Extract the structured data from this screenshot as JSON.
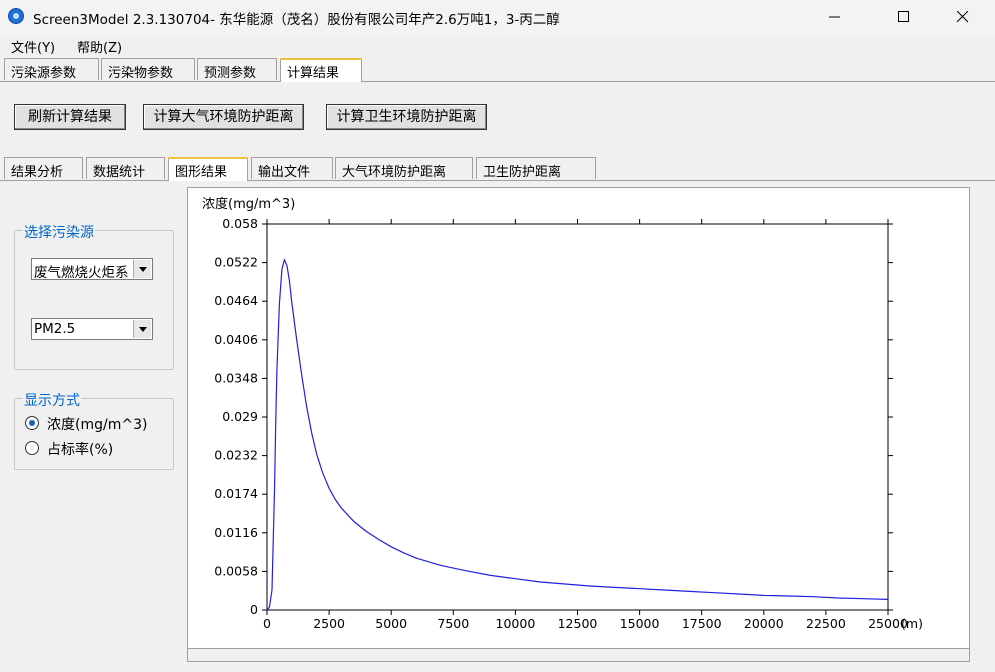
{
  "window": {
    "title": "Screen3Model 2.3.130704- 东华能源（茂名）股份有限公司年产2.6万吨1，3-丙二醇",
    "icon": "app-icon"
  },
  "menu": [
    "文件(Y)",
    "帮助(Z)"
  ],
  "main_tabs": [
    "污染源参数",
    "污染物参数",
    "预测参数",
    "计算结果"
  ],
  "main_active": "计算结果",
  "buttons": {
    "refresh": "刷新计算结果",
    "air_distance": "计算大气环境防护距离",
    "health_distance": "计算卫生环境防护距离"
  },
  "sub_tabs": [
    "结果分析",
    "数据统计",
    "图形结果",
    "输出文件",
    "大气环境防护距离",
    "卫生防护距离"
  ],
  "sub_active": "图形结果",
  "source_group": {
    "legend": "选择污染源",
    "source_value": "废气燃烧火炬系",
    "pollutant_value": "PM2.5"
  },
  "display_group": {
    "legend": "显示方式",
    "options": [
      "浓度(mg/m^3)",
      "占标率(%)"
    ],
    "selected": "浓度(mg/m^3)"
  },
  "chart_data": {
    "type": "line",
    "ylabel": "浓度(mg/m^3)",
    "xlabel_unit": "(m)",
    "x_ticks": [
      0,
      2500,
      5000,
      7500,
      10000,
      12500,
      15000,
      17500,
      20000,
      22500,
      25000
    ],
    "y_ticks": [
      0,
      0.0058,
      0.0116,
      0.0174,
      0.0232,
      0.029,
      0.0348,
      0.0406,
      0.0464,
      0.0522,
      0.058
    ],
    "y_tick_labels": [
      "0",
      "0.0058",
      "0.0116",
      "0.0174",
      "0.0232",
      "0.029",
      "0.0348",
      "0.0406",
      "0.0464",
      "0.0522",
      "0.058"
    ],
    "xlim": [
      0,
      25000
    ],
    "ylim": [
      0,
      0.058
    ],
    "line_color": "#2020e0",
    "series": [
      {
        "x": [
          0,
          50,
          100,
          200,
          300,
          350,
          400,
          500,
          600,
          700,
          800,
          900,
          1000,
          1200,
          1400,
          1600,
          1800,
          2000,
          2250,
          2500,
          2750,
          3000,
          3500,
          4000,
          4500,
          5000,
          5500,
          6000,
          7000,
          8000,
          9000,
          10000,
          11000,
          12000,
          13000,
          14000,
          15000,
          16000,
          17000,
          18000,
          19000,
          20000,
          21000,
          22000,
          23000,
          24000,
          25000
        ],
        "y": [
          0,
          0.0002,
          0.0005,
          0.003,
          0.018,
          0.028,
          0.036,
          0.046,
          0.0512,
          0.0526,
          0.0518,
          0.0495,
          0.0462,
          0.0405,
          0.0352,
          0.0305,
          0.0266,
          0.0234,
          0.0205,
          0.0183,
          0.0166,
          0.0153,
          0.0133,
          0.0118,
          0.0106,
          0.0095,
          0.0086,
          0.0078,
          0.0067,
          0.0059,
          0.0052,
          0.0047,
          0.0042,
          0.0039,
          0.0036,
          0.0034,
          0.0032,
          0.003,
          0.0028,
          0.0026,
          0.0024,
          0.0022,
          0.0021,
          0.002,
          0.0018,
          0.0017,
          0.0016
        ]
      }
    ]
  }
}
